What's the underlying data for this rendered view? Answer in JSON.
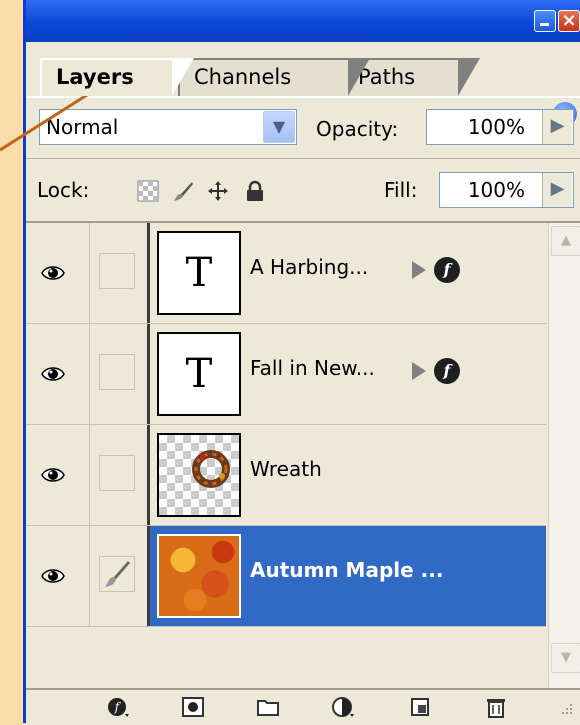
{
  "tabs": [
    {
      "label": "Layers",
      "active": true
    },
    {
      "label": "Channels",
      "active": false
    },
    {
      "label": "Paths",
      "active": false
    }
  ],
  "blend_mode": "Normal",
  "opacity": {
    "label": "Opacity:",
    "value": "100%"
  },
  "lock": {
    "label": "Lock:"
  },
  "fill": {
    "label": "Fill:",
    "value": "100%"
  },
  "layers": [
    {
      "name": "A Harbing...",
      "thumb": "text",
      "effects": true,
      "selected": false
    },
    {
      "name": "Fall in New...",
      "thumb": "text",
      "effects": true,
      "selected": false
    },
    {
      "name": "Wreath",
      "thumb": "image",
      "effects": false,
      "selected": false
    },
    {
      "name": "Autumn Maple ...",
      "thumb": "image",
      "effects": false,
      "selected": true
    }
  ],
  "thumb_text_glyph": "T",
  "colors": {
    "selection": "#316ac5",
    "titlebar": "#0a48d8",
    "annotation_arrow": "#c0641a"
  },
  "icons": {
    "window": [
      "minimize-icon",
      "close-icon",
      "panel-menu-icon"
    ],
    "lock": [
      "lock-transparency-icon",
      "lock-paint-icon",
      "lock-move-icon",
      "lock-all-icon"
    ],
    "bottom": [
      "layer-style-icon",
      "layer-mask-icon",
      "new-group-icon",
      "adjustment-layer-icon",
      "new-layer-icon",
      "delete-layer-icon"
    ]
  }
}
